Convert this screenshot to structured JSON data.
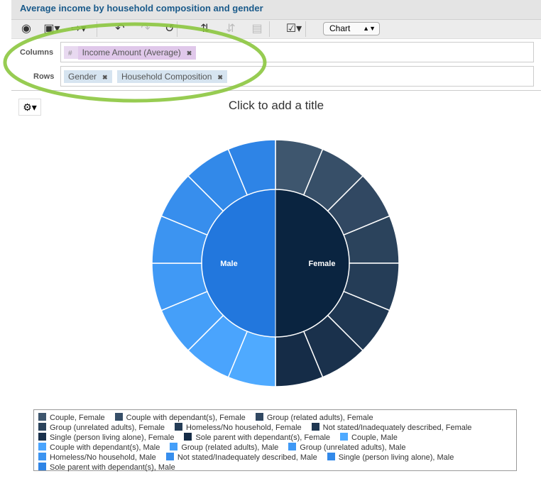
{
  "header": {
    "title": "Average income by household composition and gender"
  },
  "toolbar": {
    "icons": [
      "eye-icon",
      "save-icon",
      "export-icon",
      "undo-icon",
      "redo-icon",
      "refresh-icon",
      "swap-axes-icon",
      "sort-icon",
      "table-icon",
      "chart-options-icon"
    ],
    "view_select": "Chart"
  },
  "query": {
    "columns_label": "Columns",
    "rows_label": "Rows",
    "columns": [
      {
        "label": "Income Amount (Average)",
        "prefix": "#"
      }
    ],
    "rows": [
      {
        "label": "Gender"
      },
      {
        "label": "Household Composition"
      }
    ],
    "pill_colors": {
      "measure": "#e3d0ec",
      "dimension": "#d6e4f0"
    }
  },
  "chart_title_placeholder": "Click to add a title",
  "highlight_color": "#8cc63f",
  "chart_data": {
    "type": "sunburst",
    "title": "",
    "inner": [
      {
        "name": "Female",
        "color": "#0a2440"
      },
      {
        "name": "Male",
        "color": "#2277dd"
      }
    ],
    "outer": [
      {
        "name": "Couple, Female",
        "parent": "Female",
        "value": 1,
        "color": "#3e566e"
      },
      {
        "name": "Couple with dependant(s), Female",
        "parent": "Female",
        "value": 1,
        "color": "#374f68"
      },
      {
        "name": "Group (related adults), Female",
        "parent": "Female",
        "value": 1,
        "color": "#314862"
      },
      {
        "name": "Group (unrelated adults), Female",
        "parent": "Female",
        "value": 1,
        "color": "#2b435c"
      },
      {
        "name": "Homeless/No household, Female",
        "parent": "Female",
        "value": 1,
        "color": "#253d57"
      },
      {
        "name": "Not stated/Inadequately described, Female",
        "parent": "Female",
        "value": 1,
        "color": "#1f3752"
      },
      {
        "name": "Single (person living alone), Female",
        "parent": "Female",
        "value": 1,
        "color": "#1a314c"
      },
      {
        "name": "Sole parent with dependant(s), Female",
        "parent": "Female",
        "value": 1,
        "color": "#152c47"
      },
      {
        "name": "Couple, Male",
        "parent": "Male",
        "value": 1,
        "color": "#4faaff"
      },
      {
        "name": "Couple with dependant(s), Male",
        "parent": "Male",
        "value": 1,
        "color": "#4aa4fd"
      },
      {
        "name": "Group (related adults), Male",
        "parent": "Male",
        "value": 1,
        "color": "#459ff9"
      },
      {
        "name": "Group (unrelated adults), Male",
        "parent": "Male",
        "value": 1,
        "color": "#4099f5"
      },
      {
        "name": "Homeless/No household, Male",
        "parent": "Male",
        "value": 1,
        "color": "#3c94f1"
      },
      {
        "name": "Not stated/Inadequately described, Male",
        "parent": "Male",
        "value": 1,
        "color": "#378eed"
      },
      {
        "name": "Single (person living alone), Male",
        "parent": "Male",
        "value": 1,
        "color": "#3289e9"
      },
      {
        "name": "Sole parent with dependant(s), Male",
        "parent": "Male",
        "value": 1,
        "color": "#2e84e6"
      }
    ],
    "legend_position": "bottom"
  }
}
